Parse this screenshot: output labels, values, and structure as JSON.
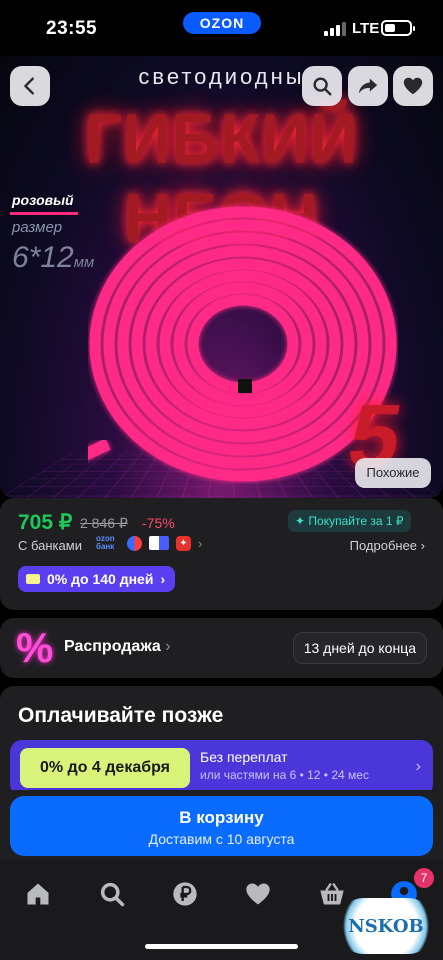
{
  "status_bar": {
    "time": "23:55",
    "carrier_pill": "OZON",
    "network": "LTE"
  },
  "hero": {
    "subtitle": "светодиодны",
    "title": "ГИБКИЙ НЕОН",
    "color_label": "розовый",
    "size_label": "размер",
    "size_value": "6*12",
    "size_unit": "мм",
    "big_number": "5",
    "similar_button": "Похожие",
    "icons": [
      "back-icon",
      "search-icon",
      "share-icon",
      "heart-icon"
    ]
  },
  "price": {
    "current": "705 ₽",
    "old": "2 846 ₽",
    "discount": "-75%",
    "promo": "Покупайте за 1 ₽",
    "banks_label": "С банками",
    "ozon_bank": "ozon банк",
    "more_link": "Подробнее",
    "installment": "0% до 140 дней"
  },
  "sale": {
    "icon": "%",
    "label": "Распродажа",
    "days_left": "13 дней до конца"
  },
  "pay_later": {
    "title": "Оплачивайте позже",
    "badge": "0% до 4 декабря",
    "line1": "Без переплат",
    "line2": "или частями на 6 • 12 • 24 мес"
  },
  "cart": {
    "label": "В корзину",
    "delivery": "Доставим с 10 августа"
  },
  "tabbar": {
    "items": [
      "home-icon",
      "search-icon",
      "ruble-icon",
      "heart-icon",
      "basket-icon",
      "profile-icon"
    ],
    "profile_badge": "7"
  },
  "watermark": "NSKOB",
  "colors": {
    "accent_blue": "#0a6bff",
    "price_green": "#1ec95a",
    "discount_red": "#ff4a6b",
    "neon_pink": "#ff2a80"
  }
}
